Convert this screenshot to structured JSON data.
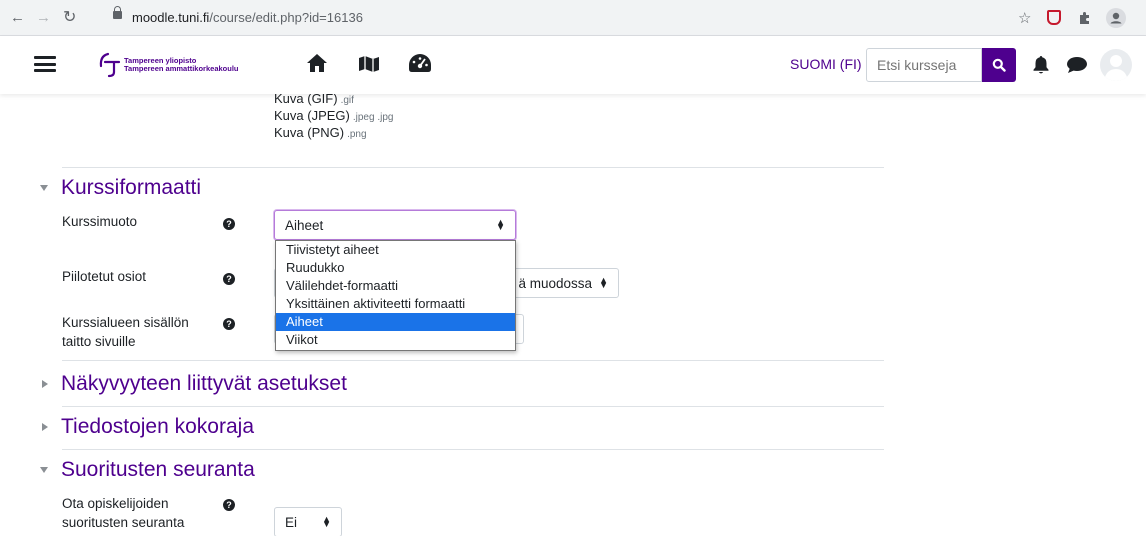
{
  "browser": {
    "url_host": "moodle.tuni.fi",
    "url_path": "/course/edit.php?id=16136"
  },
  "navbar": {
    "logo_line1": "Tampereen yliopisto",
    "logo_line2": "Tampereen ammattikorkeakoulu",
    "language": "SUOMI (FI)",
    "search_placeholder": "Etsi kursseja",
    "icons": [
      "menu-icon",
      "home-icon",
      "map-icon",
      "dashboard-icon",
      "search-icon",
      "bell-icon",
      "chat-icon",
      "avatar"
    ]
  },
  "accepted_types": [
    {
      "label": "Kuva (GIF)",
      "ext": ".gif"
    },
    {
      "label": "Kuva (JPEG)",
      "ext": ".jpeg .jpg"
    },
    {
      "label": "Kuva (PNG)",
      "ext": ".png"
    }
  ],
  "sections": {
    "kurssiformaatti": {
      "title": "Kurssiformaatti",
      "expanded": true,
      "fields": {
        "kurssimuoto": {
          "label": "Kurssimuoto",
          "value": "Aiheet",
          "options": [
            "Tiivistetyt aiheet",
            "Ruudukko",
            "Välilehdet-formaatti",
            "Yksittäinen aktiviteetti formaatti",
            "Aiheet",
            "Viikot"
          ],
          "selected_index": 4
        },
        "piilotetut": {
          "label": "Piilotetut osiot",
          "value_visible": "ä muodossa"
        },
        "taitto": {
          "label": "Kurssialueen sisällön taitto sivuille"
        }
      }
    },
    "nakyvyys": {
      "title": "Näkyvyyteen liittyvät asetukset",
      "expanded": false
    },
    "tiedostot": {
      "title": "Tiedostojen kokoraja",
      "expanded": false
    },
    "suoritukset": {
      "title": "Suoritusten seuranta",
      "expanded": true,
      "fields": {
        "seuranta": {
          "label": "Ota opiskelijoiden suoritusten seuranta käyttöön",
          "value": "Ei"
        }
      }
    }
  },
  "help_icon_glyph": "?",
  "accent_color": "#4e008e",
  "selected_option_color": "#1a73e8"
}
